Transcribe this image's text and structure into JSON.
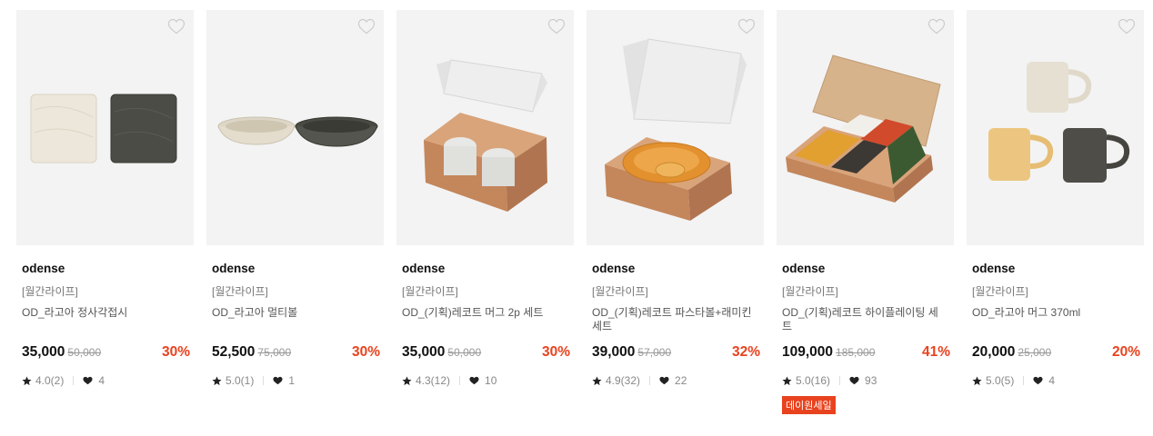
{
  "colors": {
    "accent": "#e8431f",
    "thumb_bg": "#f3f3f3"
  },
  "icons": {
    "wish": "heart-outline-icon",
    "rating": "star-icon",
    "likes": "heart-icon"
  },
  "products": [
    {
      "brand": "odense",
      "tag": "[월간라이프]",
      "name": "OD_라고아 정사각접시",
      "price": "35,000",
      "original": "50,000",
      "discount": "30%",
      "rating": "4.0(2)",
      "likes": "4",
      "badge": ""
    },
    {
      "brand": "odense",
      "tag": "[월간라이프]",
      "name": "OD_라고아 멀티볼",
      "price": "52,500",
      "original": "75,000",
      "discount": "30%",
      "rating": "5.0(1)",
      "likes": "1",
      "badge": ""
    },
    {
      "brand": "odense",
      "tag": "[월간라이프]",
      "name": "OD_(기획)레코트 머그 2p 세트",
      "price": "35,000",
      "original": "50,000",
      "discount": "30%",
      "rating": "4.3(12)",
      "likes": "10",
      "badge": ""
    },
    {
      "brand": "odense",
      "tag": "[월간라이프]",
      "name": "OD_(기획)레코트 파스타볼+래미킨 세트",
      "price": "39,000",
      "original": "57,000",
      "discount": "32%",
      "rating": "4.9(32)",
      "likes": "22",
      "badge": ""
    },
    {
      "brand": "odense",
      "tag": "[월간라이프]",
      "name": "OD_(기획)레코트 하이플레이팅 세트",
      "price": "109,000",
      "original": "185,000",
      "discount": "41%",
      "rating": "5.0(16)",
      "likes": "93",
      "badge": "데이원세일"
    },
    {
      "brand": "odense",
      "tag": "[월간라이프]",
      "name": "OD_라고아 머그 370ml",
      "price": "20,000",
      "original": "25,000",
      "discount": "20%",
      "rating": "5.0(5)",
      "likes": "4",
      "badge": ""
    }
  ]
}
